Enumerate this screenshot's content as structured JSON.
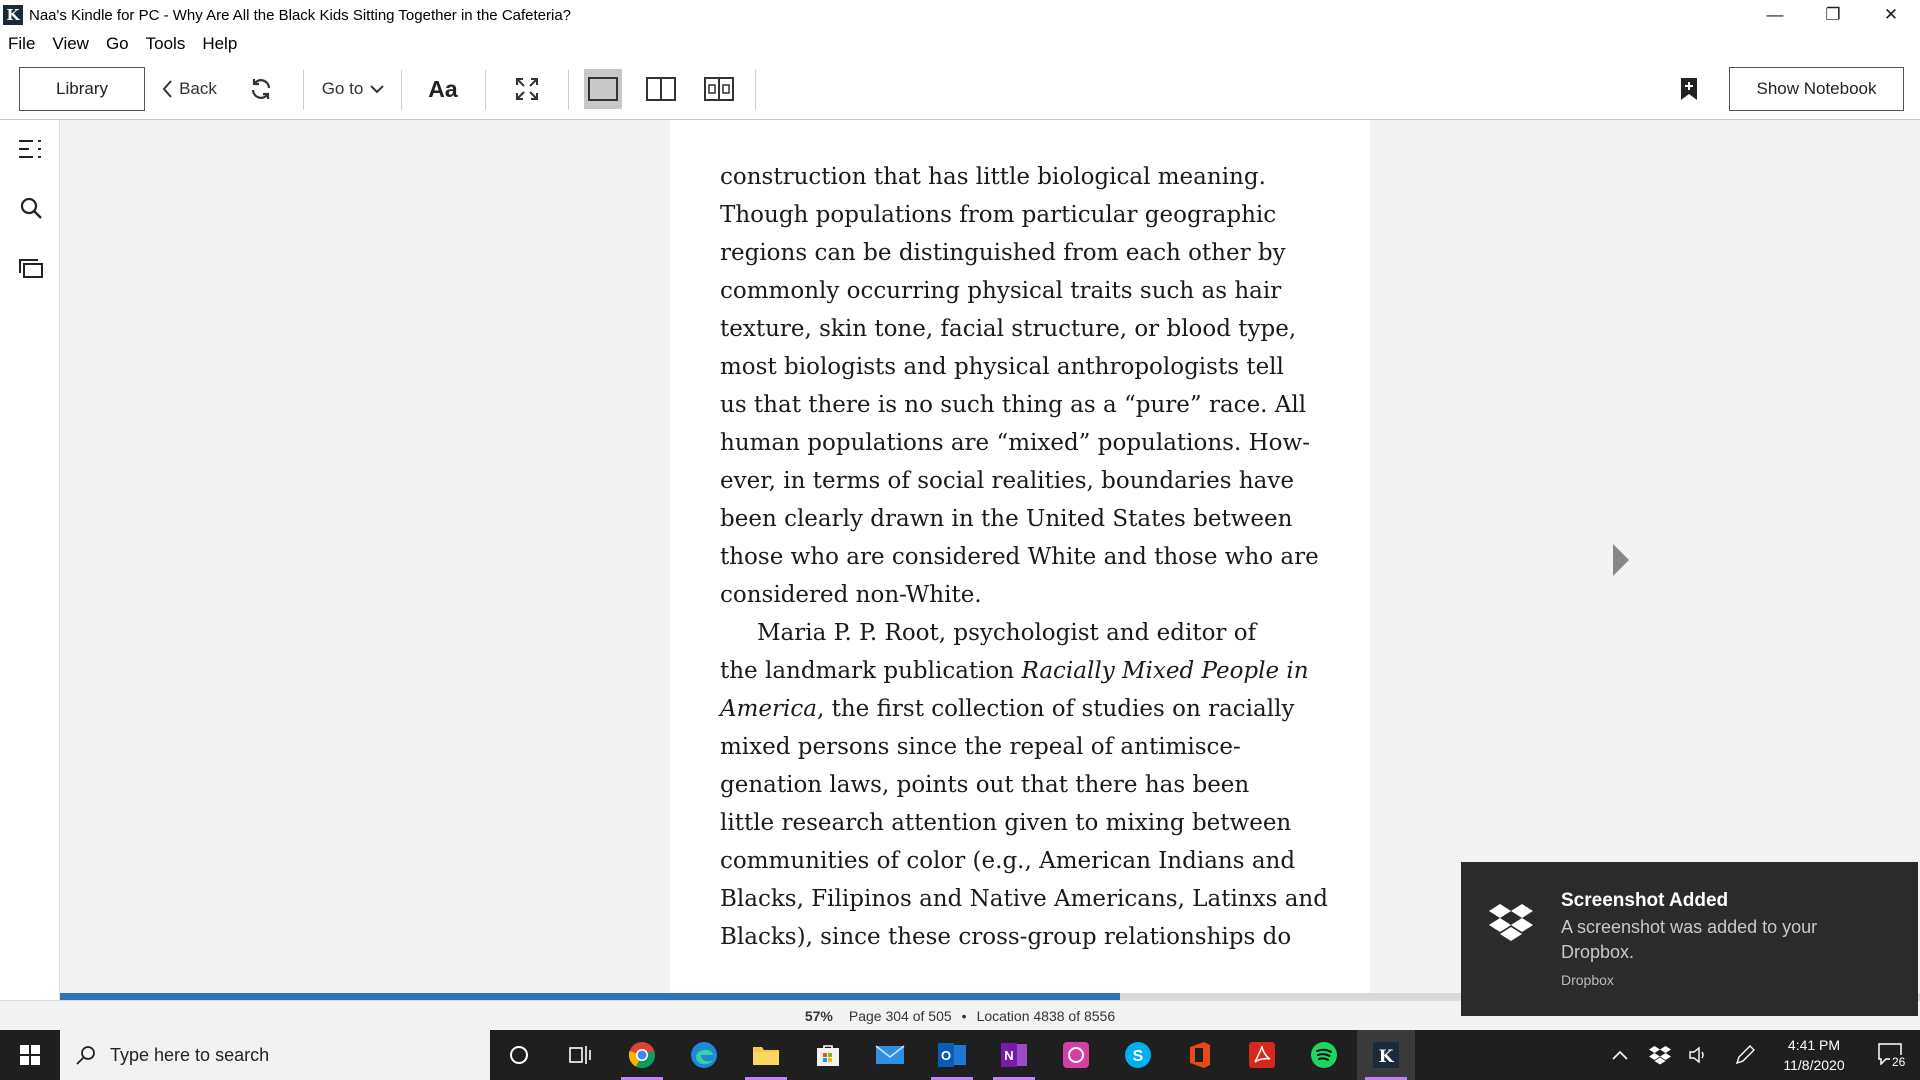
{
  "window": {
    "title": "Naa's Kindle for PC - Why Are All the Black Kids Sitting Together in the Cafeteria?",
    "app_icon_letter": "K",
    "minimize": "—",
    "restore": "❐",
    "close": "✕"
  },
  "menu": [
    "File",
    "View",
    "Go",
    "Tools",
    "Help"
  ],
  "toolbar": {
    "library_label": "Library",
    "back_label": "Back",
    "goto_label": "Go to",
    "font_label": "Aa",
    "show_notebook_label": "Show Notebook"
  },
  "book": {
    "lines": [
      "construction that has little biological meaning.",
      "Though populations from particular geographic",
      "regions can be distinguished from each other by",
      "commonly occurring physical traits such as hair",
      "texture, skin tone, facial structure, or blood type,",
      "most biologists and physical anthropologists tell",
      "us that there is no such thing as a “pure” race. All",
      "human populations are “mixed” populations. How-",
      "ever, in terms of social realities, boundaries have",
      "been clearly drawn in the United States between",
      "those who are considered White and those who are",
      "considered non-White."
    ],
    "para2_line1": "Maria P. P. Root, psychologist and editor of",
    "para2_line2_pre": "the landmark publication ",
    "para2_line2_ital": "Racially Mixed People in",
    "para2_line3_ital": "America",
    "para2_line3_post": ", the first collection of studies on racially",
    "para2_lines_rest": [
      "mixed persons since the repeal of antimisce-",
      "genation laws, points out that there has been",
      "little research attention given to mixing between",
      "communities of color (e.g., American Indians and",
      "Blacks, Filipinos and Native Americans, Latinxs and",
      "Blacks), since these cross-group relationships do"
    ]
  },
  "status": {
    "percent": "57%",
    "progress_fraction": 0.57,
    "page": "Page 304 of 505",
    "separator": "•",
    "location": "Location 4838 of 8556"
  },
  "toast": {
    "title": "Screenshot Added",
    "body": "A screenshot was added to your Dropbox.",
    "source": "Dropbox"
  },
  "taskbar": {
    "search_placeholder": "Type here to search",
    "time": "4:41 PM",
    "date": "11/8/2020",
    "notification_count": "26",
    "apps": [
      "cortana",
      "task-view",
      "chrome",
      "edge",
      "file-explorer",
      "store",
      "mail",
      "outlook",
      "onenote",
      "whatsapp",
      "skype",
      "office",
      "acrobat",
      "spotify",
      "kindle"
    ]
  },
  "colors": {
    "progress": "#2e73b9",
    "reader_bg": "#f3f3f3",
    "toast_bg": "#2b2b2b",
    "taskbar_bg": "#1f1f1f"
  }
}
